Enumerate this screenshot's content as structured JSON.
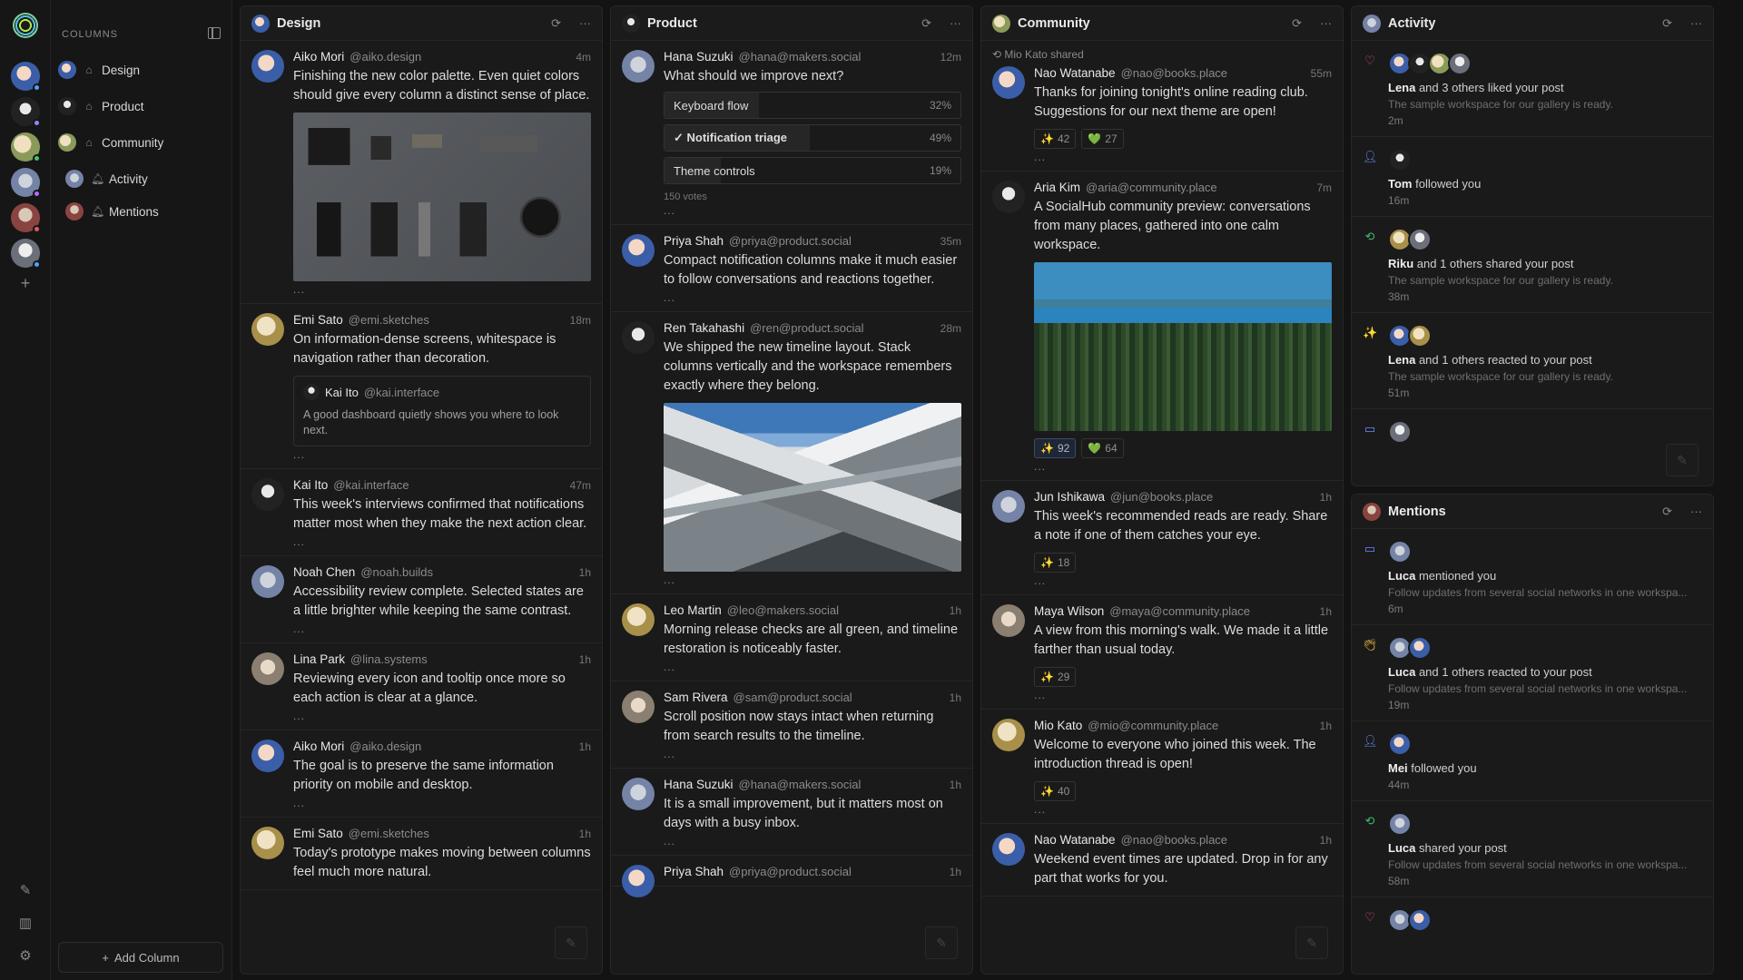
{
  "sidebar": {
    "heading": "COLUMNS",
    "items": [
      {
        "label": "Design",
        "icon": "home-icon"
      },
      {
        "label": "Product",
        "icon": "home-icon"
      },
      {
        "label": "Community",
        "icon": "home-icon"
      },
      {
        "label": "Activity",
        "icon": "bell-icon"
      },
      {
        "label": "Mentions",
        "icon": "bell-icon"
      }
    ],
    "add_column": "Add Column"
  },
  "design": {
    "title": "Design",
    "posts": [
      {
        "name": "Aiko Mori",
        "handle": "@aiko.design",
        "time": "4m",
        "text": "Finishing the new color palette. Even quiet colors should give every column a distinct sense of place."
      },
      {
        "name": "Emi Sato",
        "handle": "@emi.sketches",
        "time": "18m",
        "text": "On information-dense screens, whitespace is navigation rather than decoration.",
        "quote": {
          "name": "Kai Ito",
          "handle": "@kai.interface",
          "text": "A good dashboard quietly shows you where to look next."
        }
      },
      {
        "name": "Kai Ito",
        "handle": "@kai.interface",
        "time": "47m",
        "text": "This week's interviews confirmed that notifications matter most when they make the next action clear."
      },
      {
        "name": "Noah Chen",
        "handle": "@noah.builds",
        "time": "1h",
        "text": "Accessibility review complete. Selected states are a little brighter while keeping the same contrast."
      },
      {
        "name": "Lina Park",
        "handle": "@lina.systems",
        "time": "1h",
        "text": "Reviewing every icon and tooltip once more so each action is clear at a glance."
      },
      {
        "name": "Aiko Mori",
        "handle": "@aiko.design",
        "time": "1h",
        "text": "The goal is to preserve the same information priority on mobile and desktop."
      },
      {
        "name": "Emi Sato",
        "handle": "@emi.sketches",
        "time": "1h",
        "text": "Today's prototype makes moving between columns feel much more natural."
      }
    ]
  },
  "product": {
    "title": "Product",
    "posts": [
      {
        "name": "Hana Suzuki",
        "handle": "@hana@makers.social",
        "time": "12m",
        "text": "What should we improve next?",
        "poll": {
          "options": [
            {
              "label": "Keyboard flow",
              "pct": "32%",
              "value": 32,
              "selected": false
            },
            {
              "label": "✓ Notification triage",
              "pct": "49%",
              "value": 49,
              "selected": true
            },
            {
              "label": "Theme controls",
              "pct": "19%",
              "value": 19,
              "selected": false
            }
          ],
          "votes": "150 votes"
        }
      },
      {
        "name": "Priya Shah",
        "handle": "@priya@product.social",
        "time": "35m",
        "text": "Compact notification columns make it much easier to follow conversations and reactions together."
      },
      {
        "name": "Ren Takahashi",
        "handle": "@ren@product.social",
        "time": "28m",
        "text": "We shipped the new timeline layout. Stack columns vertically and the workspace remembers exactly where they belong."
      },
      {
        "name": "Leo Martin",
        "handle": "@leo@makers.social",
        "time": "1h",
        "text": "Morning release checks are all green, and timeline restoration is noticeably faster."
      },
      {
        "name": "Sam Rivera",
        "handle": "@sam@product.social",
        "time": "1h",
        "text": "Scroll position now stays intact when returning from search results to the timeline."
      },
      {
        "name": "Hana Suzuki",
        "handle": "@hana@makers.social",
        "time": "1h",
        "text": "It is a small improvement, but it matters most on days with a busy inbox."
      },
      {
        "name": "Priya Shah",
        "handle": "@priya@product.social",
        "time": "1h",
        "text": ""
      }
    ]
  },
  "community": {
    "title": "Community",
    "shared_by": "Mio Kato shared",
    "posts": [
      {
        "name": "Nao Watanabe",
        "handle": "@nao@books.place",
        "time": "55m",
        "text": "Thanks for joining tonight's online reading club. Suggestions for our next theme are open!",
        "reacts": [
          {
            "emoji": "✨",
            "count": "42"
          },
          {
            "emoji": "💚",
            "count": "27"
          }
        ]
      },
      {
        "name": "Aria Kim",
        "handle": "@aria@community.place",
        "time": "7m",
        "text": "A SocialHub community preview: conversations from many places, gathered into one calm workspace.",
        "reacts": [
          {
            "emoji": "✨",
            "count": "92"
          },
          {
            "emoji": "💚",
            "count": "64"
          }
        ]
      },
      {
        "name": "Jun Ishikawa",
        "handle": "@jun@books.place",
        "time": "1h",
        "text": "This week's recommended reads are ready. Share a note if one of them catches your eye.",
        "reacts": [
          {
            "emoji": "✨",
            "count": "18"
          }
        ]
      },
      {
        "name": "Maya Wilson",
        "handle": "@maya@community.place",
        "time": "1h",
        "text": "A view from this morning's walk. We made it a little farther than usual today.",
        "reacts": [
          {
            "emoji": "✨",
            "count": "29"
          }
        ]
      },
      {
        "name": "Mio Kato",
        "handle": "@mio@community.place",
        "time": "1h",
        "text": "Welcome to everyone who joined this week. The introduction thread is open!",
        "reacts": [
          {
            "emoji": "✨",
            "count": "40"
          }
        ]
      },
      {
        "name": "Nao Watanabe",
        "handle": "@nao@books.place",
        "time": "1h",
        "text": "Weekend event times are updated. Drop in for any part that works for you."
      }
    ]
  },
  "activity": {
    "title": "Activity",
    "items": [
      {
        "icon": "♡",
        "who": "Lena",
        "rest": " and 3 others liked your post",
        "sub": "The sample workspace for our gallery is ready.",
        "time": "2m"
      },
      {
        "icon": "⁺",
        "who": "Tom",
        "rest": " followed you",
        "sub": "",
        "time": "16m"
      },
      {
        "icon": "⟲",
        "who": "Riku",
        "rest": " and 1 others shared your post",
        "sub": "The sample workspace for our gallery is ready.",
        "time": "38m"
      },
      {
        "icon": "✨",
        "who": "Lena",
        "rest": " and 1 others reacted to your post",
        "sub": "The sample workspace for our gallery is ready.",
        "time": "51m"
      }
    ]
  },
  "mentions": {
    "title": "Mentions",
    "items": [
      {
        "who": "Luca",
        "rest": " mentioned you",
        "sub": "Follow updates from several social networks in one workspa...",
        "time": "6m"
      },
      {
        "who": "Luca",
        "rest": " and 1 others reacted to your post",
        "sub": "Follow updates from several social networks in one workspa...",
        "time": "19m"
      },
      {
        "who": "Mei",
        "rest": " followed you",
        "sub": "",
        "time": "44m"
      },
      {
        "who": "Luca",
        "rest": " shared your post",
        "sub": "Follow updates from several social networks in one workspa...",
        "time": "58m"
      }
    ]
  },
  "more_glyph": "...",
  "colors": {
    "background": "#131313",
    "column": "#1a1a1a",
    "accent_like": "#e05a6a",
    "accent_follow": "#6b8cff",
    "accent_share": "#3dbb6b",
    "accent_react": "#f5c542"
  }
}
